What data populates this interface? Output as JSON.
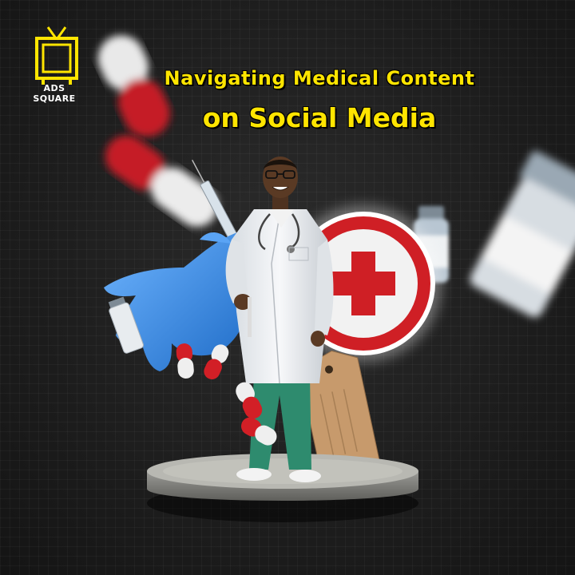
{
  "brand": {
    "name": "ADS SQUARE",
    "icon": "tv-icon",
    "color": "#ffe500"
  },
  "headline": {
    "line1": "Navigating Medical Content",
    "line2": "on Social Media",
    "color": "#ffe500"
  },
  "colors": {
    "background": "#1c1c1c",
    "accent_red": "#d21f26",
    "glove_blue": "#3d8de0"
  }
}
